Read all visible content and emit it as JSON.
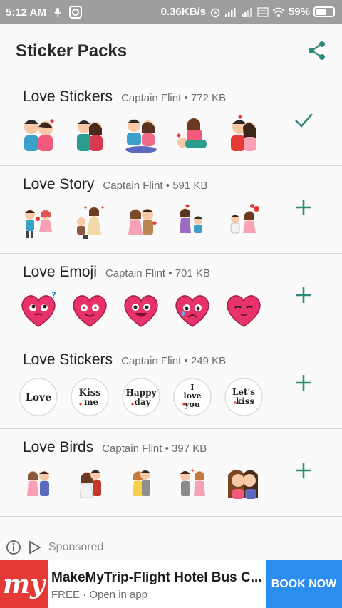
{
  "status": {
    "time": "5:12 AM",
    "speed": "0.36KB/s",
    "battery": "59%"
  },
  "app": {
    "title": "Sticker Packs",
    "accent": "#2e8b7c"
  },
  "packs": [
    {
      "name": "Love Stickers",
      "author": "Captain Flint",
      "size": "772 KB",
      "action": "check-icon"
    },
    {
      "name": "Love Story",
      "author": "Captain Flint",
      "size": "591 KB",
      "action": "add-icon"
    },
    {
      "name": "Love Emoji",
      "author": "Captain Flint",
      "size": "701 KB",
      "action": "add-icon"
    },
    {
      "name": "Love Stickers",
      "author": "Captain Flint",
      "size": "249 KB",
      "action": "add-icon"
    },
    {
      "name": "Love Birds",
      "author": "Captain Flint",
      "size": "397 KB",
      "action": "add-icon"
    }
  ],
  "sep": "•",
  "badge_texts": {
    "b1": "Love",
    "b2a": "Kiss",
    "b2b": "me",
    "b3a": "Happy",
    "b3b": "day",
    "b4a": "I",
    "b4b": "love",
    "b4c": "you",
    "b5a": "Let's",
    "b5b": "kiss"
  },
  "ad": {
    "sponsored": "Sponsored",
    "logo": "my",
    "title": "MakeMyTrip-Flight Hotel Bus C...",
    "subtitle": "FREE · Open in app",
    "cta": "BOOK NOW"
  }
}
